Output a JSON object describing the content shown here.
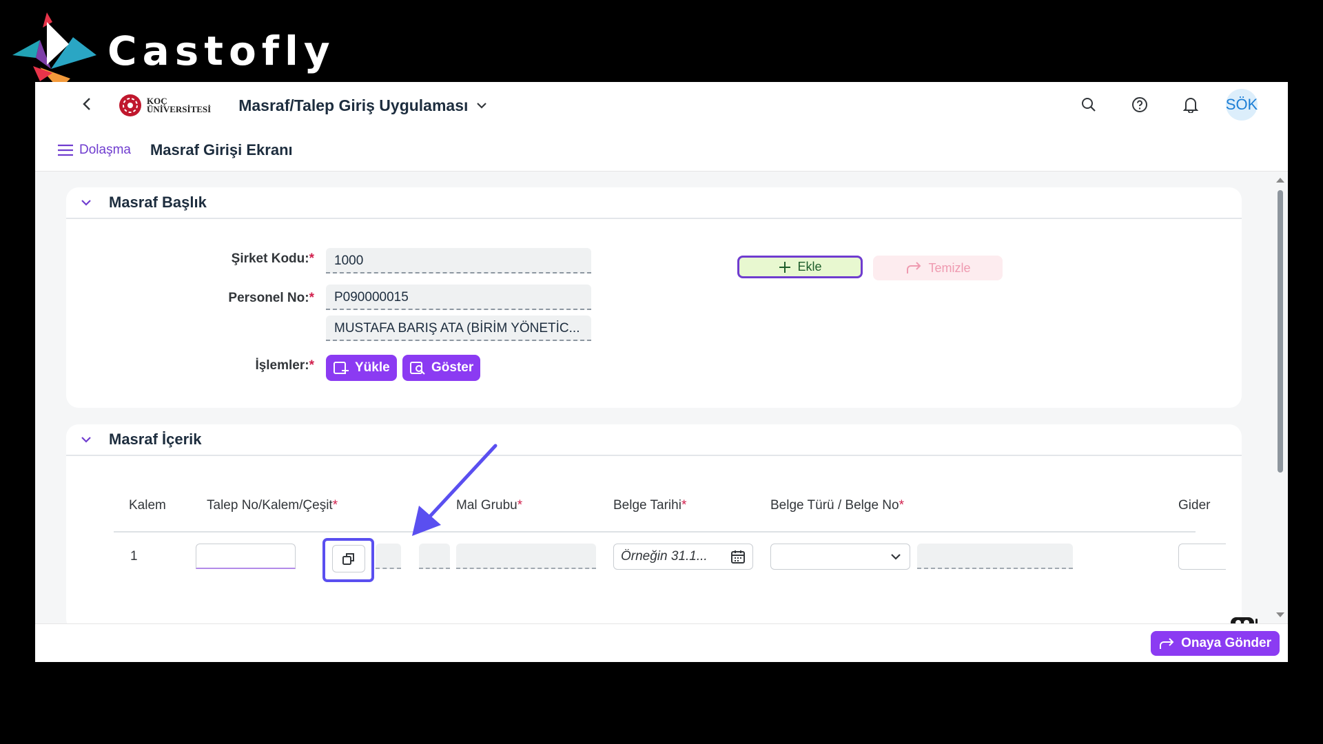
{
  "brand": {
    "name": "Castofly"
  },
  "shell": {
    "org_line1": "KOÇ",
    "org_line2": "ÜNİVERSİTESİ",
    "app_title": "Masraf/Talep Giriş Uygulaması",
    "avatar_initials": "SÖK"
  },
  "subheader": {
    "nav_label": "Dolaşma",
    "page_title": "Masraf Girişi Ekranı"
  },
  "header_panel": {
    "title": "Masraf Başlık",
    "company_code_label": "Şirket Kodu:",
    "company_code_value": "1000",
    "personnel_label": "Personel No:",
    "personnel_value": "P090000015",
    "personnel_name": "MUSTAFA BARIŞ  ATA (BİRİM YÖNETİC...",
    "operations_label": "İşlemler:",
    "upload_label": "Yükle",
    "show_label": "Göster",
    "add_label": "Ekle",
    "clear_label": "Temizle",
    "required_mark": "*"
  },
  "content_panel": {
    "title": "Masraf İçerik",
    "columns": [
      "Kalem",
      "Talep No/Kalem/Çeşit",
      "Mal Grubu",
      "Belge Tarihi",
      "Belge Türü / Belge No",
      "Gider Ka"
    ],
    "row_index": "1",
    "date_placeholder": "Örneğin 31.1..."
  },
  "footer": {
    "submit_label": "Onaya Gönder"
  },
  "colors": {
    "accent": "#8b3bf2",
    "required": "#d1204d",
    "highlight": "#5a4ff0"
  }
}
